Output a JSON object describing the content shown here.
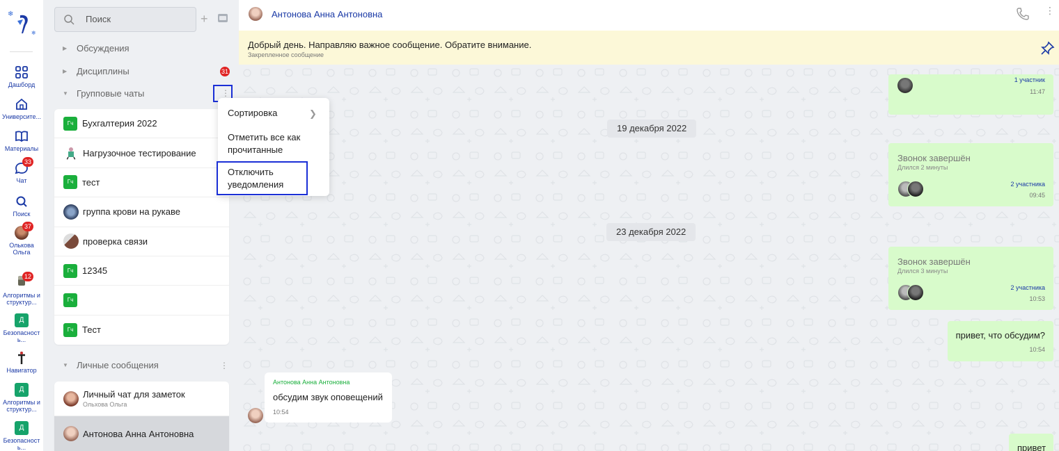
{
  "rail": {
    "items": [
      {
        "label": "Дашборд",
        "icon": "grid-icon"
      },
      {
        "label": "Университе...",
        "icon": "home-icon"
      },
      {
        "label": "Материалы",
        "icon": "book-icon"
      },
      {
        "label": "Чат",
        "icon": "chat-icon",
        "badge": "33"
      },
      {
        "label": "Поиск",
        "icon": "search-icon"
      },
      {
        "label": "Олькова Ольга",
        "icon": "avatar",
        "badge": "37"
      },
      {
        "label": "Алгоритмы и структур...",
        "icon": "avatar",
        "badge": "12"
      },
      {
        "label": "Безопасност ь...",
        "tile": "Д"
      },
      {
        "label": "Навигатор",
        "icon": "avatar"
      },
      {
        "label": "Алгоритмы и структур...",
        "tile": "Д"
      },
      {
        "label": "Безопасност ь...",
        "tile": "Д"
      }
    ]
  },
  "list": {
    "search_placeholder": "Поиск",
    "sections": {
      "discussions": "Обсуждения",
      "disciplines": "Дисциплины",
      "disciplines_badge": "31",
      "group_chats": "Групповые чаты",
      "personal": "Личные сообщения"
    },
    "group_chats": [
      {
        "name": "Бухгалтерия 2022",
        "kind": "tile",
        "tile": "Гч"
      },
      {
        "name": "Нагрузочное тестирование",
        "kind": "avatar"
      },
      {
        "name": "тест",
        "kind": "tile",
        "tile": "Гч"
      },
      {
        "name": "группа крови на рукаве",
        "kind": "avatar"
      },
      {
        "name": "проверка связи",
        "kind": "avatar"
      },
      {
        "name": "12345",
        "kind": "tile",
        "tile": "Гч"
      },
      {
        "name": "",
        "kind": "tile",
        "tile": "Гч"
      },
      {
        "name": "Тест",
        "kind": "tile",
        "tile": "Гч"
      }
    ],
    "personal_chats": [
      {
        "name": "Личный чат для заметок",
        "sub": "Ольхова Ольга"
      },
      {
        "name": "Антонова Анна Антоновна",
        "sub": ""
      }
    ]
  },
  "menu": {
    "sort": "Сортировка",
    "mark_read": "Отметить все как прочитанные",
    "mute": "Отключить уведомления"
  },
  "chat": {
    "title": "Антонова Анна Антоновна",
    "pinned_text": "Добрый день. Направляю важное сообщение. Обратите внимание.",
    "pinned_label": "Закрепленное сообщение",
    "top_bubble": {
      "participants": "1 участник",
      "time": "11:47"
    },
    "date1": "19 декабря 2022",
    "call1": {
      "title": "Звонок завершён",
      "duration": "Длился 2 минуты",
      "participants": "2 участника",
      "time": "09:45"
    },
    "date2": "23 декабря 2022",
    "call2": {
      "title": "Звонок завершён",
      "duration": "Длился 3 минуты",
      "participants": "2 участника",
      "time": "10:53"
    },
    "msg_out": {
      "text": "привет, что обсудим?",
      "time": "10:54"
    },
    "msg_in": {
      "author": "Антонова Анна Антоновна",
      "text": "обсудим звук оповещений",
      "time": "10:54"
    },
    "msg_out2": {
      "text": "привет"
    }
  },
  "colors": {
    "accent": "#1b3aa6",
    "focus": "#1a2fd6",
    "green_tile": "#1aaf3c",
    "badge": "#e02424",
    "bubble_out": "#d8fbcb",
    "pinned_bg": "#fcf8d8"
  }
}
